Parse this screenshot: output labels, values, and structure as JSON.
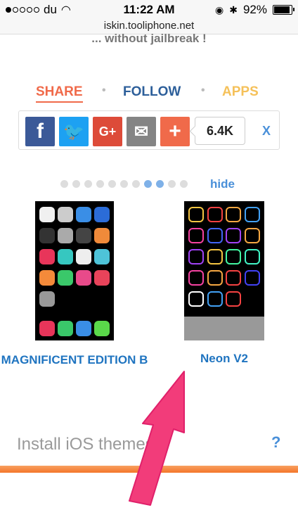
{
  "status": {
    "carrier": "du",
    "time": "11:22 AM",
    "battery": "92%",
    "battery_level": 0.92
  },
  "url": "iskin.tooliphone.net",
  "tagline": "... without jailbreak !",
  "nav": {
    "share": "SHARE",
    "follow": "FOLLOW",
    "apps": "APPS"
  },
  "share": {
    "count": "6.4K",
    "close": "X",
    "buttons": [
      "facebook-icon",
      "twitter-icon",
      "google-plus-icon",
      "email-icon",
      "plus-icon"
    ]
  },
  "carousel": {
    "hide": "hide",
    "total_pages": 11,
    "active_pages": [
      8,
      9
    ]
  },
  "themes": [
    {
      "name": "MAGNIFICENT EDITION B"
    },
    {
      "name": "Neon V2"
    }
  ],
  "install": {
    "text": "Install iOS themes",
    "help": "?"
  }
}
